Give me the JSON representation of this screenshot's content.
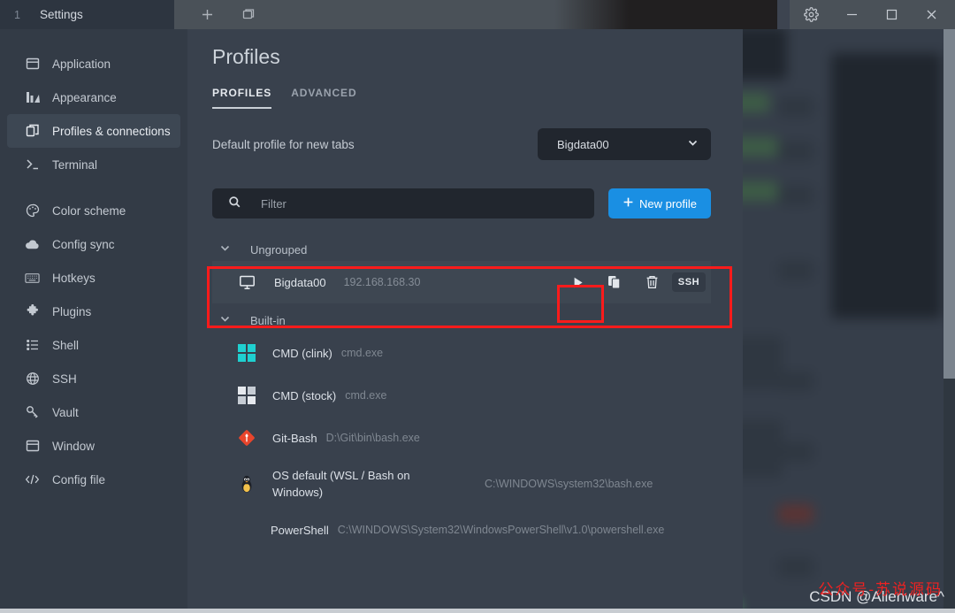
{
  "window": {
    "tab_index": "1",
    "tab_title": "Settings",
    "new_tab_label": "+",
    "split_label": "split-window",
    "gear_label": "settings",
    "minimize_label": "minimize",
    "maximize_label": "maximize",
    "close_label": "close"
  },
  "sidebar": {
    "items": [
      {
        "label": "Application",
        "icon": "window-icon",
        "active": false
      },
      {
        "label": "Appearance",
        "icon": "appearance-icon",
        "active": false
      },
      {
        "label": "Profiles & connections",
        "icon": "profiles-icon",
        "active": true
      },
      {
        "label": "Terminal",
        "icon": "terminal-prompt-icon",
        "active": false
      },
      {
        "label": "Color scheme",
        "icon": "palette-icon",
        "active": false
      },
      {
        "label": "Config sync",
        "icon": "cloud-icon",
        "active": false
      },
      {
        "label": "Hotkeys",
        "icon": "keyboard-icon",
        "active": false
      },
      {
        "label": "Plugins",
        "icon": "puzzle-icon",
        "active": false
      },
      {
        "label": "Shell",
        "icon": "list-icon",
        "active": false
      },
      {
        "label": "SSH",
        "icon": "globe-icon",
        "active": false
      },
      {
        "label": "Vault",
        "icon": "key-icon",
        "active": false
      },
      {
        "label": "Window",
        "icon": "window-icon",
        "active": false
      },
      {
        "label": "Config file",
        "icon": "code-icon",
        "active": false
      }
    ]
  },
  "main": {
    "title": "Profiles",
    "tabs": [
      {
        "label": "PROFILES",
        "active": true
      },
      {
        "label": "ADVANCED",
        "active": false
      }
    ],
    "default_profile": {
      "label": "Default profile for new tabs",
      "selected": "Bigdata00"
    },
    "filter": {
      "placeholder": "Filter",
      "value": ""
    },
    "new_profile_button": "New profile",
    "new_profile_plus": "+",
    "groups": [
      {
        "name": "Ungrouped",
        "expanded": true,
        "profiles": [
          {
            "name": "Bigdata00",
            "detail": "192.168.168.30",
            "icon": "monitor-icon",
            "selected": true,
            "actions": [
              {
                "name": "connect-play-button",
                "label": "play"
              },
              {
                "name": "duplicate-button",
                "label": "duplicate"
              },
              {
                "name": "delete-button",
                "label": "delete"
              },
              {
                "name": "ssh-badge",
                "label": "SSH"
              }
            ]
          }
        ]
      },
      {
        "name": "Built-in",
        "expanded": true,
        "profiles": [
          {
            "name": "CMD (clink)",
            "detail": "cmd.exe",
            "icon": "windows-logo-cyan-icon",
            "selected": false
          },
          {
            "name": "CMD (stock)",
            "detail": "cmd.exe",
            "icon": "windows-logo-white-icon",
            "selected": false
          },
          {
            "name": "Git-Bash",
            "detail": "D:\\Git\\bin\\bash.exe",
            "icon": "git-icon",
            "selected": false
          },
          {
            "name": "OS default (WSL / Bash on Windows)",
            "detail": "C:\\WINDOWS\\system32\\bash.exe",
            "icon": "linux-tux-icon",
            "selected": false
          },
          {
            "name": "PowerShell",
            "detail": "C:\\WINDOWS\\System32\\WindowsPowerShell\\v1.0\\powershell.exe",
            "icon": "none",
            "selected": false
          }
        ]
      }
    ]
  },
  "watermark": {
    "text": "CSDN @Alienware^",
    "overlay_text": "公众号-苏说源码"
  },
  "colors": {
    "accent": "#1a8fe3",
    "annotation": "#fb1b1b",
    "panel": "#39414d",
    "sidebar": "#333b46",
    "input": "#21262e",
    "selected_row": "#3e4752"
  }
}
